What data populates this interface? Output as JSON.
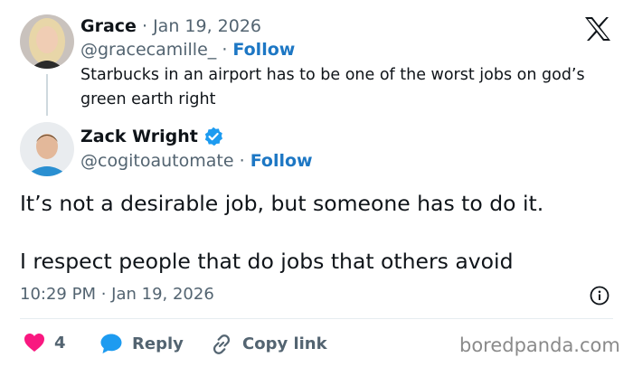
{
  "original_tweet": {
    "author_name": "Grace",
    "separator": "·",
    "date": "Jan 19, 2026",
    "handle": "@gracecamille_",
    "follow_label": "Follow",
    "text": "Starbucks in an airport has to be one of the worst jobs on god’s green earth right"
  },
  "reply": {
    "author_name": "Zack Wright",
    "handle": "@cogitoautomate",
    "separator": "·",
    "follow_label": "Follow",
    "verified": true,
    "text_line1": "It’s not a desirable job, but someone has to do it.",
    "text_line2": "I respect people that do jobs that others avoid",
    "timestamp": "10:29 PM · Jan 19, 2026"
  },
  "actions": {
    "like_count": "4",
    "reply_label": "Reply",
    "copy_link_label": "Copy link"
  },
  "watermark": "boredpanda.com",
  "colors": {
    "follow": "#1d77c4",
    "verified": "#1d9bf0",
    "like": "#f91880",
    "reply_icon": "#1d9bf0",
    "muted": "#536471"
  },
  "icons": [
    "x-logo-icon",
    "verified-badge-icon",
    "info-icon",
    "heart-icon",
    "reply-bubble-icon",
    "link-icon"
  ]
}
